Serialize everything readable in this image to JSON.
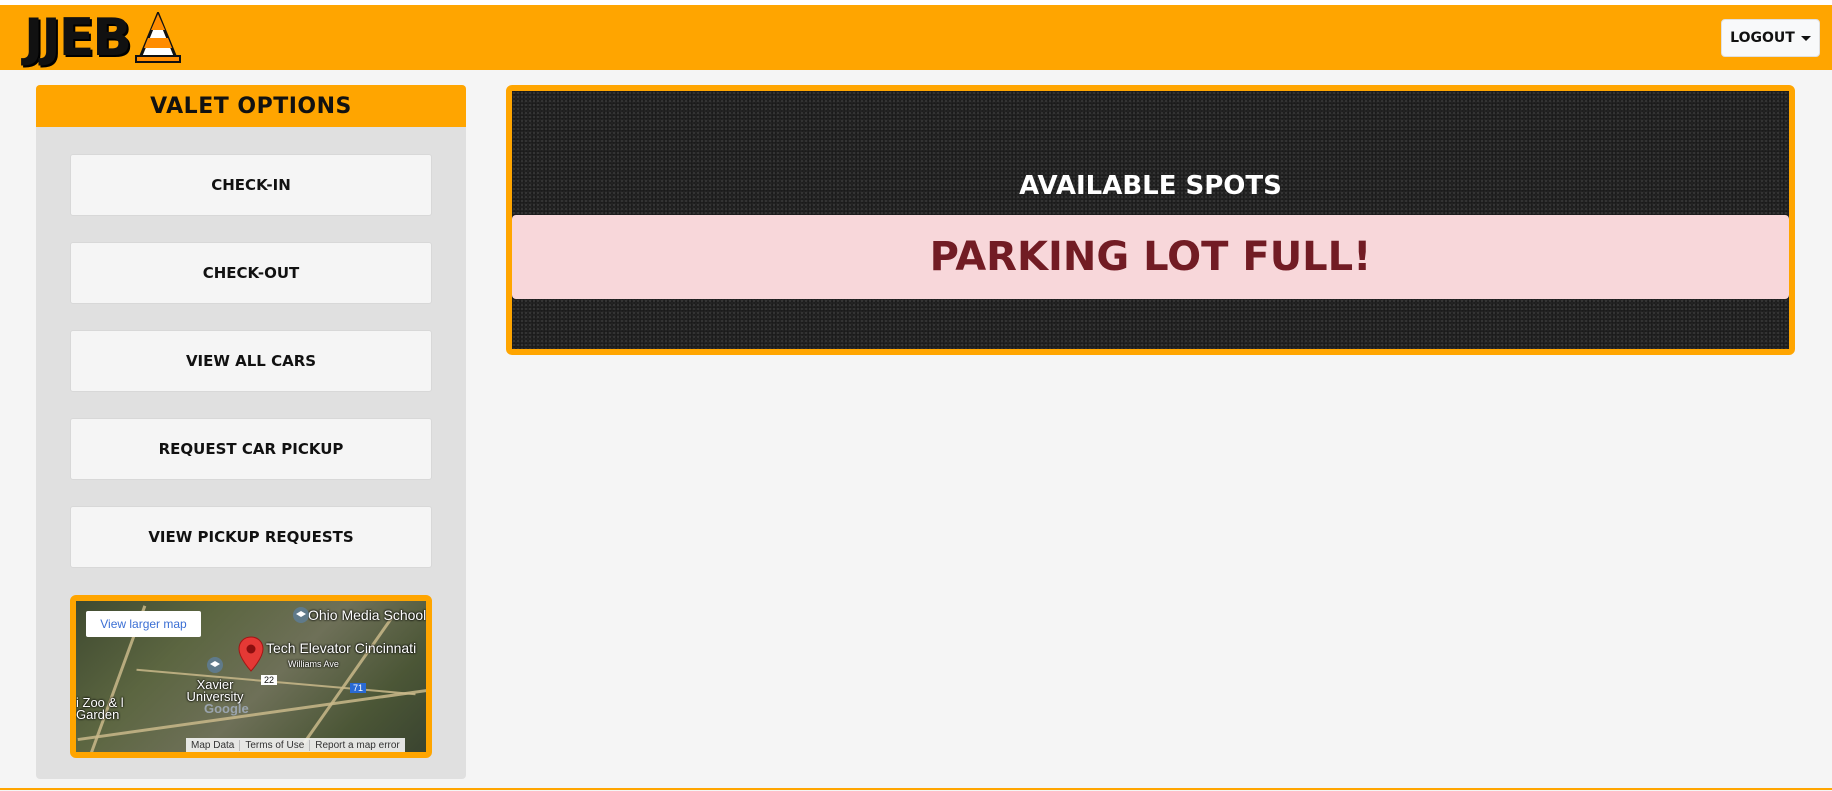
{
  "brand": {
    "logo_text": "JJEB",
    "logo_icon": "traffic-cone-icon"
  },
  "header": {
    "logout_label": "LOGOUT"
  },
  "sidebar": {
    "title": "VALET OPTIONS",
    "buttons": [
      {
        "label": "CHECK-IN"
      },
      {
        "label": "CHECK-OUT"
      },
      {
        "label": "VIEW ALL CARS"
      },
      {
        "label": "REQUEST CAR PICKUP"
      },
      {
        "label": "VIEW PICKUP REQUESTS"
      }
    ],
    "map": {
      "view_larger": "View larger map",
      "labels": {
        "school": "Ohio Media School",
        "tech": "Tech Elevator Cincinnati",
        "street": "Williams Ave",
        "university": "Xavier University",
        "zoo": "i Zoo & l Garden",
        "route22": "22",
        "route71": "71"
      },
      "footer": [
        "Map Data",
        "Terms of Use",
        "Report a map error"
      ],
      "google": "Google"
    }
  },
  "main": {
    "spots_title": "AVAILABLE SPOTS",
    "status": "PARKING LOT FULL!"
  },
  "colors": {
    "accent": "#ffa500",
    "alert_bg": "#f8d7da",
    "alert_text": "#721c24",
    "background": "#f5f5f5"
  }
}
